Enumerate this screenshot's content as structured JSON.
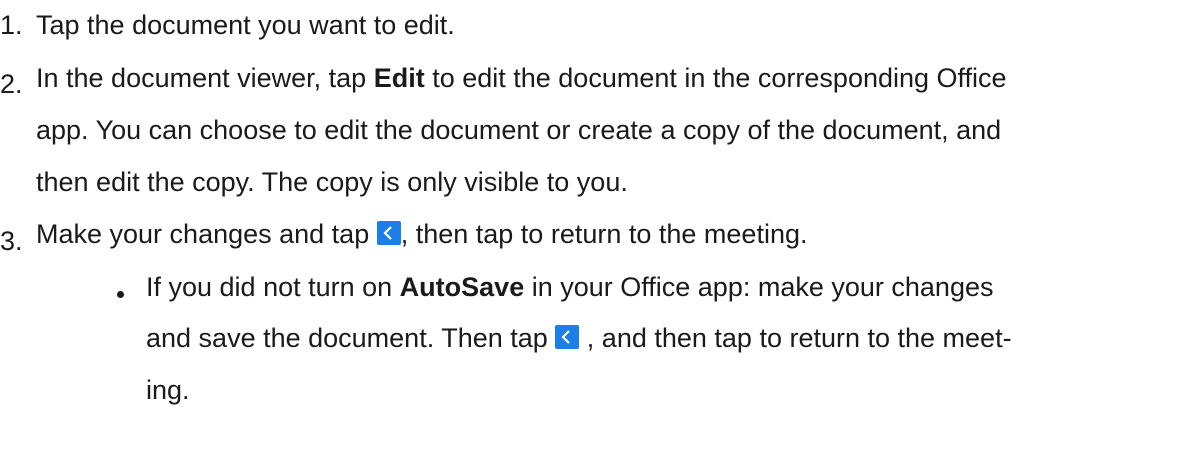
{
  "steps": [
    {
      "num": "1.",
      "text": "Tap the document you want to edit."
    },
    {
      "num": "2.",
      "line1_pre": "In the document viewer, tap ",
      "line1_bold": "Edit",
      "line1_post": " to edit the document in the corresponding Office",
      "line2": "app. You can choose to edit the document or create a copy of the document, and",
      "line3": "then edit the copy. The copy is only visible to you."
    },
    {
      "num": "3.",
      "pre": "Make your changes and tap ",
      "post": ", then tap  to return to the meeting."
    }
  ],
  "note": {
    "line1_pre": "If you did not turn on ",
    "line1_bold": "AutoSave",
    "line1_post": "  in your Office app: make your changes",
    "line2_pre": "and save the document. Then tap ",
    "line2_post": " , and then tap  to return to the meet-",
    "line3": "ing."
  },
  "icons": {
    "back": "back-chevron-icon",
    "color": "#1e7ee8"
  }
}
